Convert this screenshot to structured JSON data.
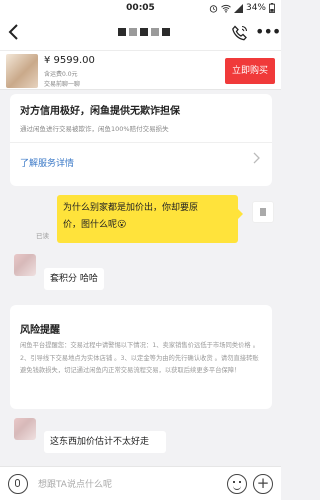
{
  "status_bar": {
    "time": "00:05",
    "battery": "34%"
  },
  "nav": {
    "back_icon": "back-arrow-icon",
    "call_icon": "phone-icon",
    "more_icon": "more-dots-icon",
    "more_label": "•••"
  },
  "product": {
    "price": "¥ 9599.00",
    "shipping": "含运费0.0元",
    "process": "交易前聊一聊",
    "buy_label": "立即购买",
    "accent": "#f03a3a"
  },
  "guarantee": {
    "title": "对方信用极好，闲鱼提供无欺诈担保",
    "description": "通过闲鱼进行交易被欺诈，闲鱼100%赔付交易损失",
    "link": "了解服务详情",
    "link_color": "#3b79c7"
  },
  "messages": {
    "me_1": {
      "line1": "为什么别家都是加价出，你却要原",
      "line2": "价，图什么呢😮",
      "bubble_color": "#ffe33b"
    },
    "read_status": "已读",
    "other_1": "套积分 哈哈",
    "other_2": "这东西加价估计不太好走"
  },
  "risk": {
    "title": "风险提醒",
    "body": "闲鱼平台提醒您：交易过程中请警惕以下情况：1、卖家销售价远低于市场同类价格 。2、引导线下交易地点为实体店铺 。3、以定金等为由的先行确认收货 。请勿直接转账避免钱款损失，切记通过闲鱼内正常交易流程交易，以获取后续更多平台保障！"
  },
  "input": {
    "placeholder": "想跟TA说点什么呢"
  }
}
